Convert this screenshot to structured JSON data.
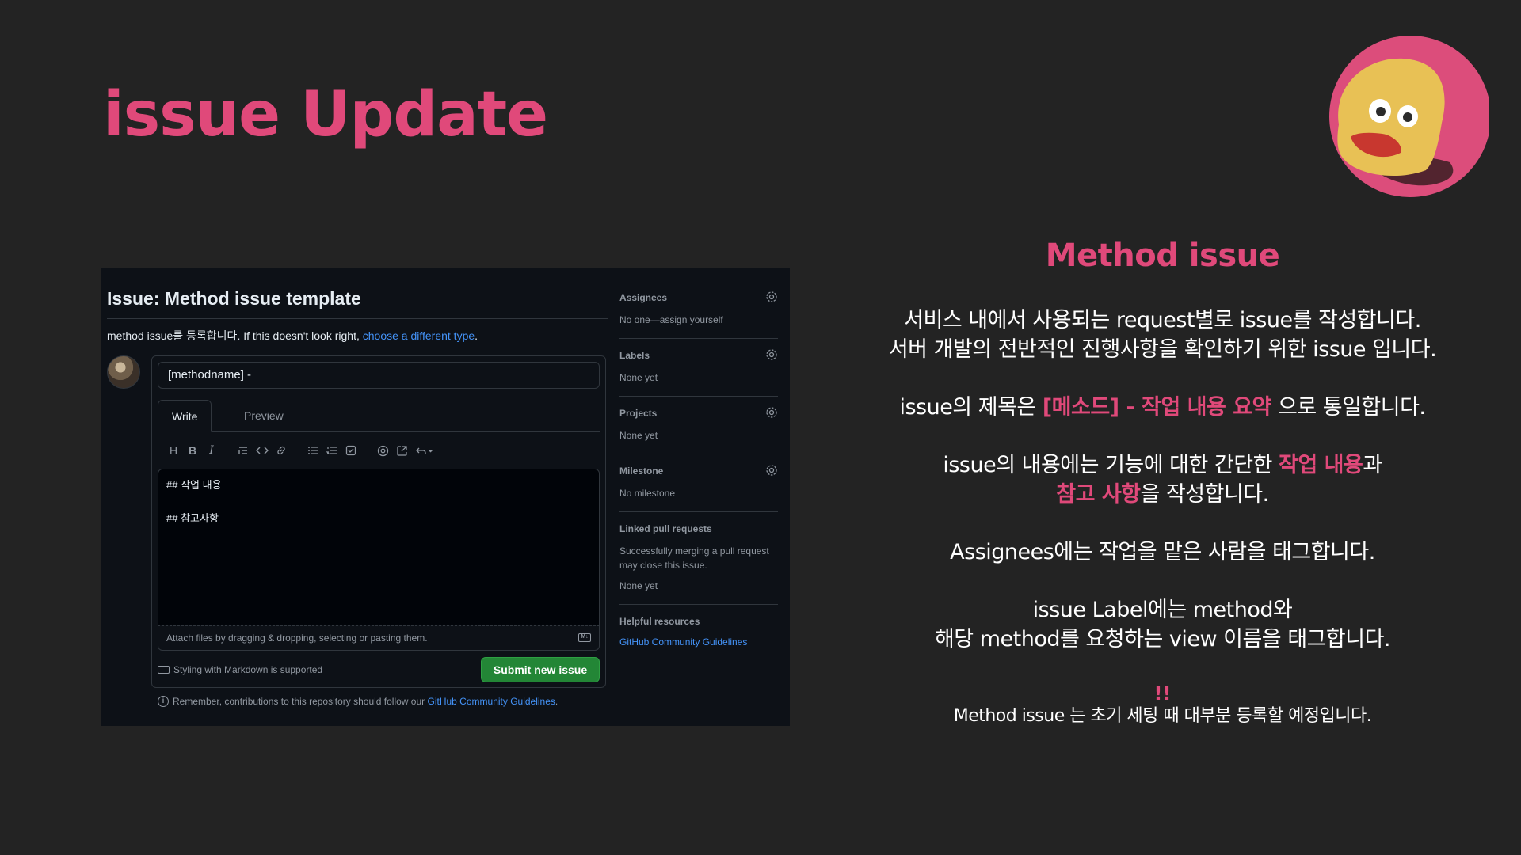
{
  "slide": {
    "title": "issue Update"
  },
  "screenshot": {
    "issue_title": "Issue: Method issue template",
    "subline_text": "method issue를 등록합니다. If this doesn't look right, ",
    "subline_link": "choose a different type",
    "subline_end": ".",
    "title_input_value": "[methodname] -",
    "tabs": [
      {
        "label": "Write",
        "active": true
      },
      {
        "label": "Preview",
        "active": false
      }
    ],
    "toolbar_icons": [
      "heading-icon",
      "bold-icon",
      "italic-icon",
      "quote-icon",
      "code-icon",
      "link-icon",
      "unordered-list-icon",
      "ordered-list-icon",
      "task-list-icon",
      "mention-icon",
      "reference-icon",
      "undo-icon"
    ],
    "toolbar_glyphs": {
      "heading": "H",
      "bold": "B",
      "italic": "I"
    },
    "editor_line1": "## 작업 내용",
    "editor_line2": "## 참고사항",
    "attach_text": "Attach files by dragging & dropping, selecting or pasting them.",
    "markdown_note": "Styling with Markdown is supported",
    "submit_label": "Submit new issue",
    "remember_text": "Remember, contributions to this repository should follow our ",
    "remember_link": "GitHub Community Guidelines",
    "remember_end": ".",
    "sidebar": {
      "assignees": {
        "heading": "Assignees",
        "value": "No one—assign yourself"
      },
      "labels": {
        "heading": "Labels",
        "value": "None yet"
      },
      "projects": {
        "heading": "Projects",
        "value": "None yet"
      },
      "milestone": {
        "heading": "Milestone",
        "value": "No milestone"
      },
      "linked_prs": {
        "heading": "Linked pull requests",
        "desc": "Successfully merging a pull request may close this issue.",
        "value": "None yet"
      },
      "helpful": {
        "heading": "Helpful resources",
        "link": "GitHub Community Guidelines"
      }
    }
  },
  "explanation": {
    "title": "Method issue",
    "para1_line1": "서비스 내에서 사용되는 request별로 issue를 작성합니다.",
    "para1_line2": "서버 개발의 전반적인 진행사항을 확인하기 위한 issue 입니다.",
    "para2_pre": "issue의 제목은 ",
    "para2_hl": "[메소드] - 작업 내용 요약",
    "para2_post": " 으로 통일합니다.",
    "para3_pre": "issue의 내용에는 기능에 대한 간단한 ",
    "para3_hl1": "작업 내용",
    "para3_mid": "과",
    "para3_hl2": "참고 사항",
    "para3_post": "을 작성합니다.",
    "para4": "Assignees에는 작업을 맡은 사람을 태그합니다.",
    "para5_line1": "issue Label에는 method와",
    "para5_line2": "해당 method를 요청하는 view 이름을 태그합니다.",
    "alert": "!!",
    "note": "Method issue 는 초기 세팅 때 대부분 등록할 예정입니다."
  },
  "colors": {
    "accent": "#e0497a",
    "background": "#232323",
    "github_bg": "#0d1117",
    "submit_green": "#238636",
    "link_blue": "#4493f8"
  }
}
